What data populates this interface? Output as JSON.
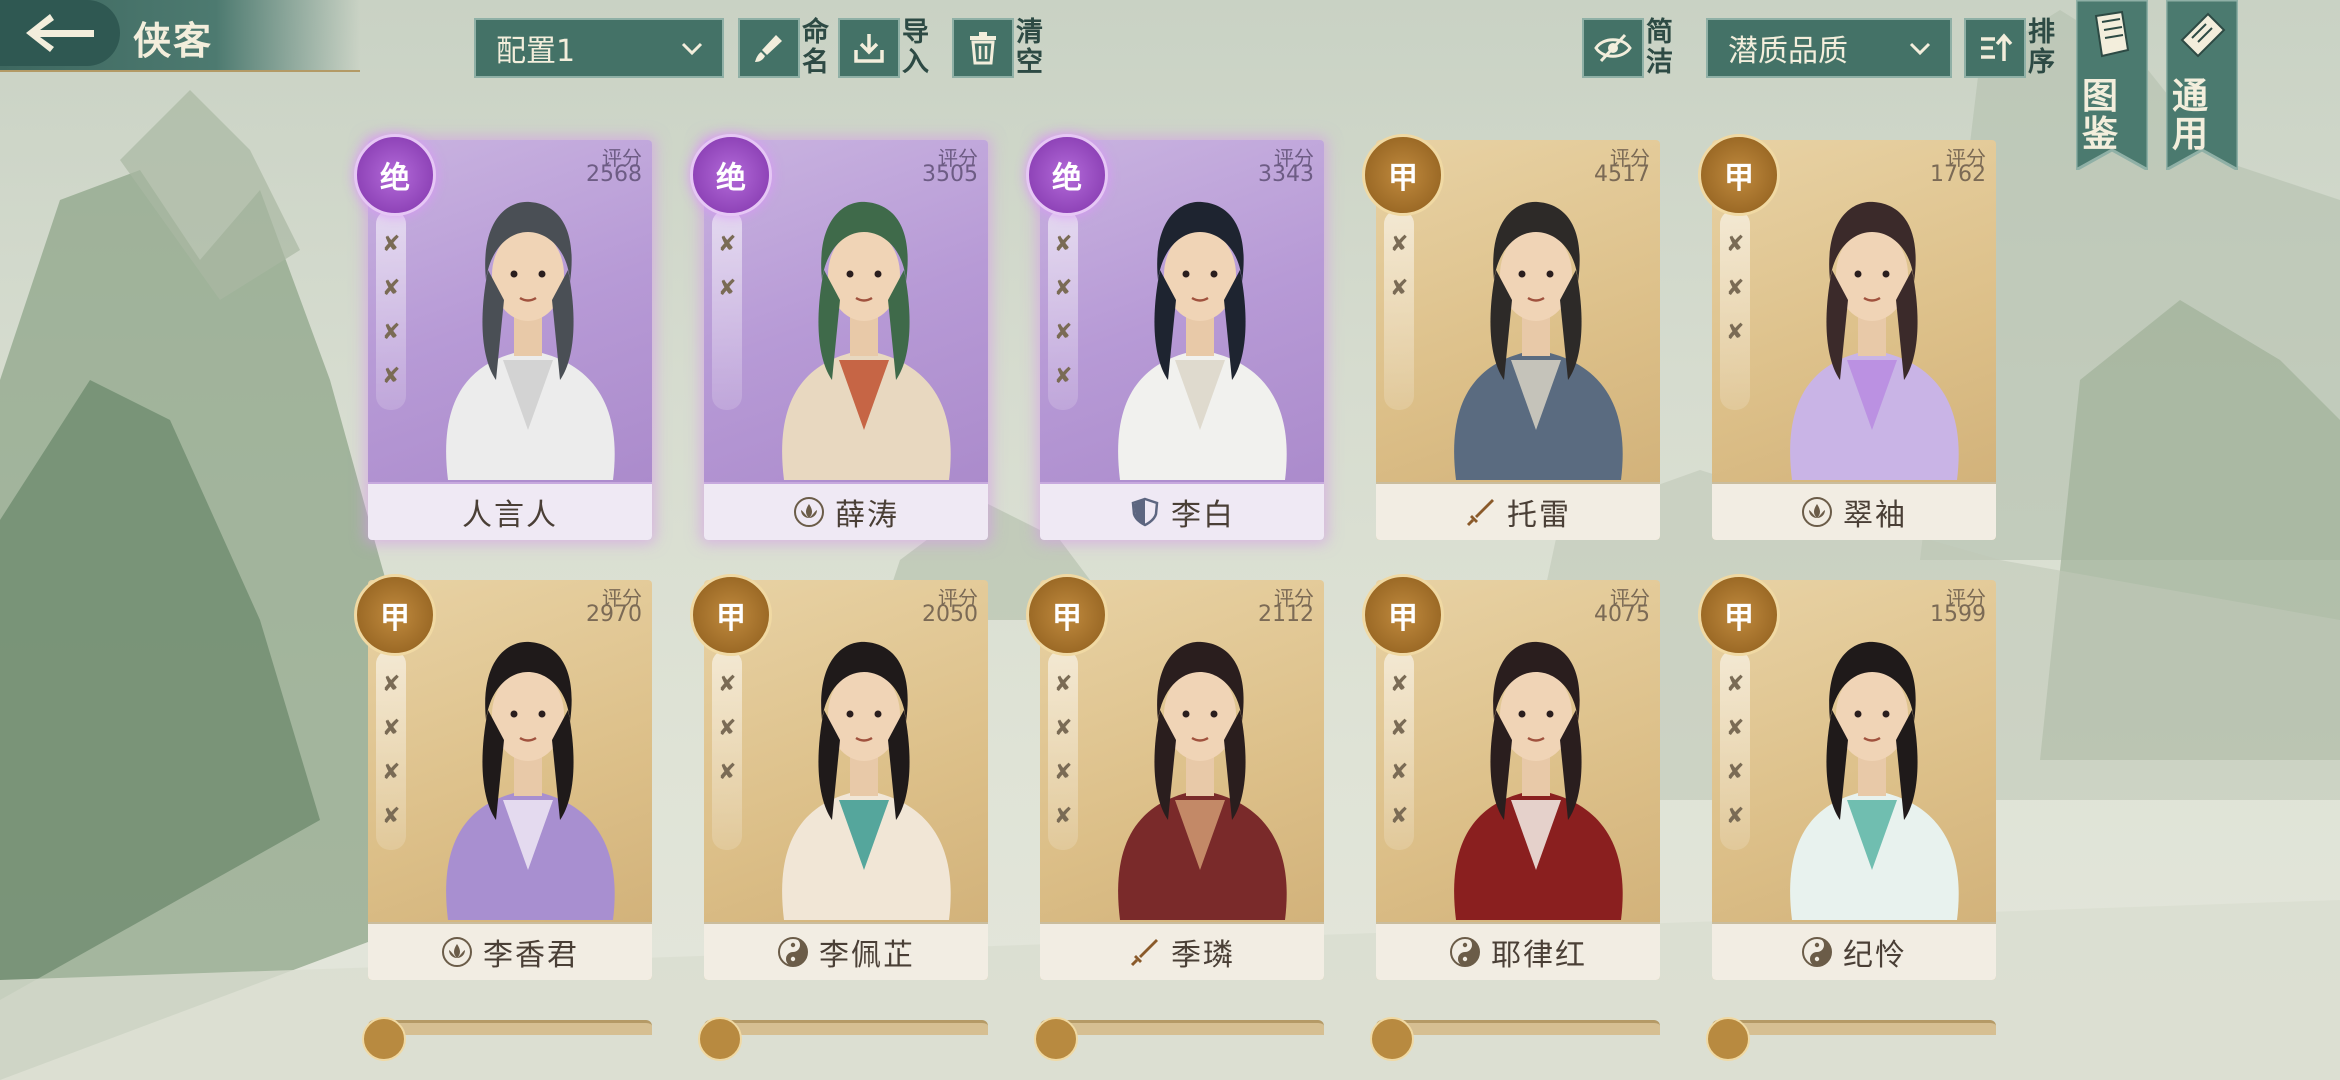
{
  "header": {
    "title": "侠客"
  },
  "toolbar": {
    "config_select": "配置1",
    "rename": "命名",
    "import": "导入",
    "clear": "清空",
    "simplify": "简洁",
    "sort_select": "潜质品质",
    "sort": "排序"
  },
  "bookmarks": {
    "codex": "图鉴",
    "general": "通用"
  },
  "cards": [
    {
      "name": "人言人",
      "grade": "绝",
      "score_label": "评分",
      "score": "2568",
      "sect_icon": "none-icon",
      "pens": 4,
      "tier": "jue",
      "palette": [
        "#ececec",
        "#4a4f55",
        "#cfcfcf"
      ]
    },
    {
      "name": "薛涛",
      "grade": "绝",
      "score_label": "评分",
      "score": "3505",
      "sect_icon": "lotus-icon",
      "pens": 2,
      "tier": "jue",
      "palette": [
        "#e8d8c0",
        "#3f6a4a",
        "#c0512f"
      ]
    },
    {
      "name": "李白",
      "grade": "绝",
      "score_label": "评分",
      "score": "3343",
      "sect_icon": "shield-icon",
      "pens": 4,
      "tier": "jue",
      "palette": [
        "#f1f1ee",
        "#1e2430",
        "#dcd6c8"
      ]
    },
    {
      "name": "托雷",
      "grade": "甲",
      "score_label": "评分",
      "score": "4517",
      "sect_icon": "sword-icon",
      "pens": 2,
      "tier": "jia",
      "palette": [
        "#5a6b80",
        "#2d2a28",
        "#d8d2c4"
      ]
    },
    {
      "name": "翠袖",
      "grade": "甲",
      "score_label": "评分",
      "score": "1762",
      "sect_icon": "lotus-icon",
      "pens": 3,
      "tier": "jia",
      "palette": [
        "#c9b4e6",
        "#3b2a2a",
        "#b98be0"
      ]
    },
    {
      "name": "李香君",
      "grade": "甲",
      "score_label": "评分",
      "score": "2970",
      "sect_icon": "lotus-icon",
      "pens": 4,
      "tier": "jia",
      "palette": [
        "#a88fd0",
        "#1f1a1a",
        "#efe7f5"
      ]
    },
    {
      "name": "李佩芷",
      "grade": "甲",
      "score_label": "评分",
      "score": "2050",
      "sect_icon": "yinyang-icon",
      "pens": 3,
      "tier": "jia",
      "palette": [
        "#f1e6d6",
        "#1f1a1a",
        "#3a9a92"
      ]
    },
    {
      "name": "季璘",
      "grade": "甲",
      "score_label": "评分",
      "score": "2112",
      "sect_icon": "sword-icon",
      "pens": 4,
      "tier": "jia",
      "palette": [
        "#7a2a2a",
        "#2a1e1e",
        "#d09a72"
      ]
    },
    {
      "name": "耶律红",
      "grade": "甲",
      "score_label": "评分",
      "score": "4075",
      "sect_icon": "yinyang-icon",
      "pens": 4,
      "tier": "jia",
      "palette": [
        "#8a1f1f",
        "#2a1e1e",
        "#f4f1ea"
      ]
    },
    {
      "name": "纪怜",
      "grade": "甲",
      "score_label": "评分",
      "score": "1599",
      "sect_icon": "yinyang-icon",
      "pens": 4,
      "tier": "jia",
      "palette": [
        "#e8f2ee",
        "#1f1a1a",
        "#5bb5a5"
      ]
    }
  ]
}
